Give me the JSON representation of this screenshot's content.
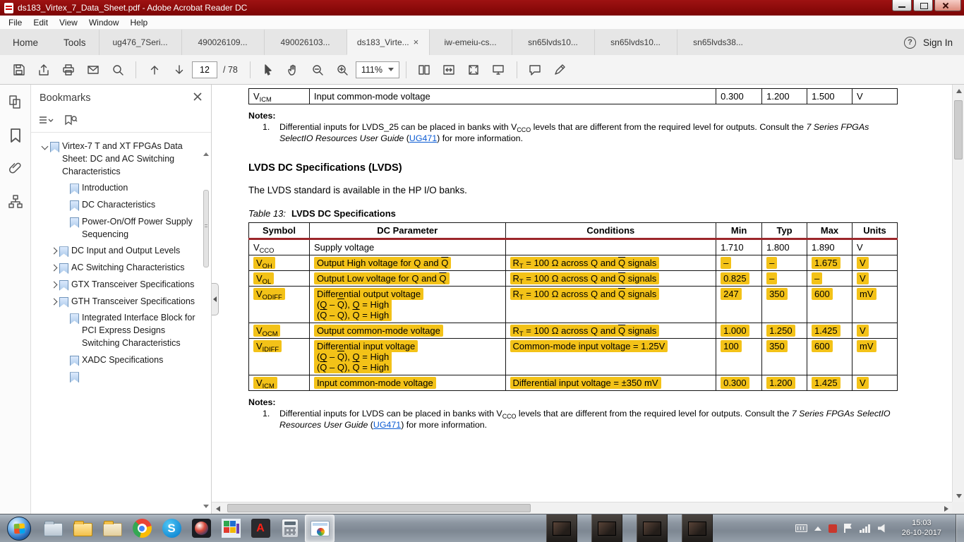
{
  "window": {
    "title": "ds183_Virtex_7_Data_Sheet.pdf - Adobe Acrobat Reader DC"
  },
  "icons": {
    "close_tab": "×",
    "help": "?",
    "skype": "S",
    "adobe": "A"
  },
  "menu": {
    "items": [
      "File",
      "Edit",
      "View",
      "Window",
      "Help"
    ]
  },
  "tabs": {
    "home": "Home",
    "tools": "Tools",
    "docs": [
      "ug476_7Seri...",
      "490026109...",
      "490026103...",
      "ds183_Virte...",
      "iw-emeiu-cs...",
      "sn65lvds10...",
      "sn65lvds10...",
      "sn65lvds38..."
    ],
    "sign_in": "Sign In"
  },
  "toolbar": {
    "page_current": "12",
    "page_total": "/ 78",
    "zoom": "111%"
  },
  "panel": {
    "title": "Bookmarks",
    "items": [
      "Virtex-7 T and XT FPGAs Data Sheet: DC and AC Switching Characteristics",
      "Introduction",
      "DC Characteristics",
      "Power-On/Off Power Supply Sequencing",
      "DC Input and Output Levels",
      "AC Switching Characteristics",
      "GTX Transceiver Specifications",
      "GTH Transceiver Specifications",
      "Integrated Interface Block for PCI Express Designs Switching Characteristics",
      "XADC Specifications"
    ]
  },
  "doc": {
    "prev_table_row": {
      "symbol": "V<sub>ICM</sub>",
      "param": "Input common-mode voltage",
      "min": "0.300",
      "typ": "1.200",
      "max": "1.500",
      "units": "V"
    },
    "notes1_heading": "Notes:",
    "notes1_num": "1.",
    "notes1_html": "Differential inputs for LVDS_25 can be placed in banks with V<sub>CCO</sub> levels that are different from the required level for outputs. Consult the <i>7 Series FPGAs SelectIO Resources User Guide</i> (<span class=\"link\">UG471</span>) for more information.",
    "heading": "LVDS DC Specifications (LVDS)",
    "intro": "The LVDS standard is available in the HP I/O banks.",
    "caption_label": "Table  13:",
    "caption_title": "LVDS DC Specifications",
    "table": {
      "headers": [
        "Symbol",
        "DC Parameter",
        "Conditions",
        "Min",
        "Typ",
        "Max",
        "Units"
      ],
      "rows": [
        {
          "symbol": "V<sub>CCO</sub>",
          "param": "Supply voltage",
          "cond": "",
          "min": "1.710",
          "typ": "1.800",
          "max": "1.890",
          "units": "V",
          "hl": false
        },
        {
          "symbol": "V<sub>OH</sub>",
          "param": "Output High voltage for Q and <span class=\"ov\">Q</span>",
          "cond": "R<sub>T</sub> = 100 Ω across Q and <span class=\"ov\">Q</span> signals",
          "min": "–",
          "typ": "–",
          "max": "1.675",
          "units": "V",
          "hl": true
        },
        {
          "symbol": "V<sub>OL</sub>",
          "param": "Output Low voltage for Q and <span class=\"ov\">Q</span>",
          "cond": "R<sub>T</sub> = 100 Ω across Q and <span class=\"ov\">Q</span> signals",
          "min": "0.825",
          "typ": "–",
          "max": "–",
          "units": "V",
          "hl": true
        },
        {
          "symbol": "V<sub>ODIFF</sub>",
          "param": "Differential output voltage<br>(Q – <span class=\"ov\">Q</span>), Q = High<br>(<span class=\"ov\">Q</span> – Q), <span class=\"ov\">Q</span> = High",
          "cond": "R<sub>T</sub> = 100 Ω across Q and <span class=\"ov\">Q</span> signals",
          "min": "247",
          "typ": "350",
          "max": "600",
          "units": "mV",
          "hl": true
        },
        {
          "symbol": "V<sub>OCM</sub>",
          "param": "Output common-mode voltage",
          "cond": "R<sub>T</sub> = 100 Ω across Q and <span class=\"ov\">Q</span> signals",
          "min": "1.000",
          "typ": "1.250",
          "max": "1.425",
          "units": "V",
          "hl": true
        },
        {
          "symbol": "V<sub>IDIFF</sub>",
          "param": "Differential input voltage<br>(Q – <span class=\"ov\">Q</span>), Q = High<br>(<span class=\"ov\">Q</span> – Q), <span class=\"ov\">Q</span> = High",
          "cond": "Common-mode input voltage = 1.25V",
          "min": "100",
          "typ": "350",
          "max": "600",
          "units": "mV",
          "hl": true
        },
        {
          "symbol": "V<sub>ICM</sub>",
          "param": "Input common-mode voltage",
          "cond": "Differential input voltage = ±350 mV",
          "min": "0.300",
          "typ": "1.200",
          "max": "1.425",
          "units": "V",
          "hl": true
        }
      ]
    },
    "notes2_heading": "Notes:",
    "notes2_num": "1.",
    "notes2_html": "Differential inputs for LVDS can be placed in banks with V<sub>CCO</sub> levels that are different from the required level for outputs. Consult the <i>7 Series FPGAs SelectIO Resources User Guide</i> (<span class=\"link\">UG471</span>) for more information."
  },
  "taskbar": {
    "time": "15:03",
    "date": "26-10-2017"
  }
}
